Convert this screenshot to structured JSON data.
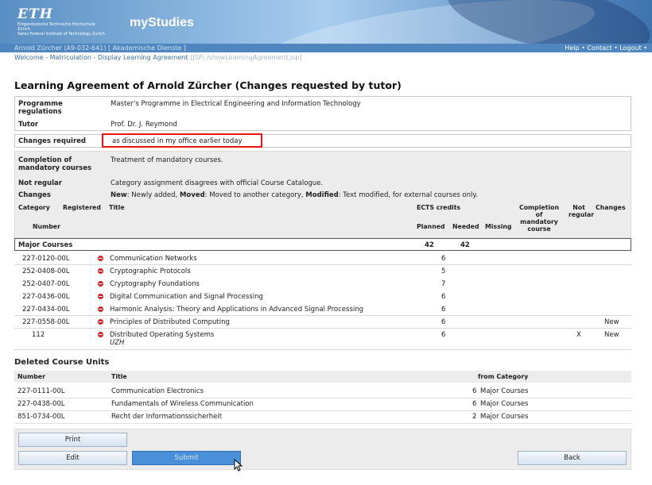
{
  "header": {
    "logo": "ETH",
    "logo_sub1": "Eidgenössische Technische Hochschule Zürich",
    "logo_sub2": "Swiss Federal Institute of Technology Zurich",
    "app_name": "myStudies"
  },
  "userbar": {
    "user": "Arnold Zürcher (A9-032-641) [ Akademische Dienste ]",
    "help": "Help",
    "contact": "Contact",
    "logout": "Logout"
  },
  "breadcrumb": {
    "welcome": "Welcome",
    "matriculation": "Matriculation",
    "current": "Display Learning Agreement",
    "jsp": "[JSP: /showLearningAgreement.jsp]"
  },
  "page_title": "Learning Agreement of Arnold Zürcher (Changes requested by tutor)",
  "info": {
    "programme_label": "Programme regulations",
    "programme_value": "Master's Programme in Electrical Engineering and Information Technology",
    "tutor_label": "Tutor",
    "tutor_value": "Prof. Dr. J. Reymond",
    "changes_required_label": "Changes required",
    "changes_required_value": "as discussed in my office earlier today"
  },
  "legend": {
    "completion_label": "Completion of mandatory courses",
    "completion_value": "Treatment of mandatory courses.",
    "notregular_label": "Not regular",
    "notregular_value": "Category assignment disagrees with official Course Catalogue.",
    "changes_label": "Changes",
    "changes_new": "New",
    "changes_new_desc": ": Newly added, ",
    "changes_moved": "Moved",
    "changes_moved_desc": ": Moved to another category, ",
    "changes_modified": "Modified",
    "changes_modified_desc": ": Text modified, for external courses only."
  },
  "table": {
    "headers": {
      "category": "Category",
      "number": "Number",
      "registered": "Registered",
      "title": "Title",
      "ects": "ECTS credits",
      "planned": "Planned",
      "needed": "Needed",
      "missing": "Missing",
      "completion": "Completion of mandatory course",
      "not_regular": "Not regular",
      "changes": "Changes"
    },
    "category": {
      "name": "Major Courses",
      "planned": "42",
      "needed": "42"
    },
    "rows": [
      {
        "number": "227-0120-00L",
        "title": "Communication Networks",
        "sub": "",
        "planned": "6",
        "not_regular": "",
        "change": ""
      },
      {
        "number": "252-0408-00L",
        "title": "Cryptographic Protocols",
        "sub": "",
        "planned": "5",
        "not_regular": "",
        "change": ""
      },
      {
        "number": "252-0407-00L",
        "title": "Cryptography Foundations",
        "sub": "",
        "planned": "7",
        "not_regular": "",
        "change": ""
      },
      {
        "number": "227-0436-00L",
        "title": "Digital Communication and Signal Processing",
        "sub": "",
        "planned": "6",
        "not_regular": "",
        "change": ""
      },
      {
        "number": "227-0434-00L",
        "title": "Harmonic Analysis: Theory and Applications in Advanced Signal Processing",
        "sub": "",
        "planned": "6",
        "not_regular": "",
        "change": ""
      },
      {
        "number": "227-0558-00L",
        "title": "Principles of Distributed Computing",
        "sub": "",
        "planned": "6",
        "not_regular": "",
        "change": "New"
      },
      {
        "number": "112",
        "title": "Distributed Operating Systems",
        "sub": "UZH",
        "planned": "6",
        "not_regular": "X",
        "change": "New"
      }
    ]
  },
  "deleted": {
    "title": "Deleted Course Units",
    "headers": {
      "number": "Number",
      "title": "Title",
      "from": "from Category"
    },
    "rows": [
      {
        "number": "227-0111-00L",
        "title": "Communication Electronics",
        "credits": "6",
        "category": "Major Courses"
      },
      {
        "number": "227-0438-00L",
        "title": "Fundamentals of Wireless Communication",
        "credits": "6",
        "category": "Major Courses"
      },
      {
        "number": "851-0734-00L",
        "title": "Recht der Informationssicherheit",
        "credits": "2",
        "category": "Major Courses"
      }
    ]
  },
  "buttons": {
    "print": "Print",
    "edit": "Edit",
    "submit": "Submit",
    "back": "Back"
  }
}
